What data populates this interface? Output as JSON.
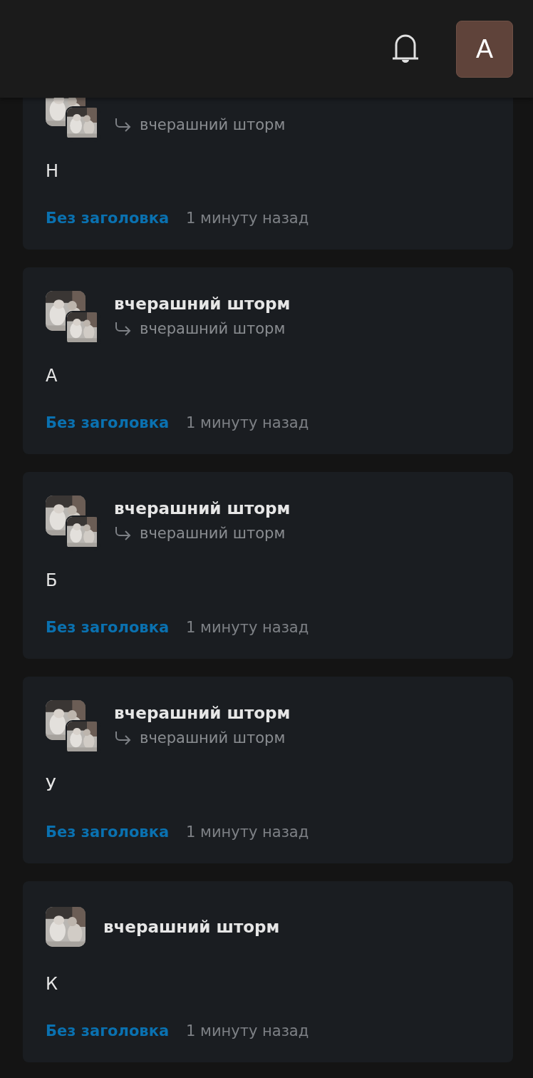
{
  "header": {
    "avatar_letter": "A"
  },
  "posts": [
    {
      "reply_to": "вчерашний шторм",
      "text": "Н",
      "title": "Без заголовка",
      "time": "1 минуту назад"
    },
    {
      "author": "вчерашний шторм",
      "reply_to": "вчерашний шторм",
      "text": "А",
      "title": "Без заголовка",
      "time": "1 минуту назад"
    },
    {
      "author": "вчерашний шторм",
      "reply_to": "вчерашний шторм",
      "text": "Б",
      "title": "Без заголовка",
      "time": "1 минуту назад"
    },
    {
      "author": "вчерашний шторм",
      "reply_to": "вчерашний шторм",
      "text": "У",
      "title": "Без заголовка",
      "time": "1 минуту назад"
    },
    {
      "author": "вчерашний шторм",
      "text": "К",
      "title": "Без заголовка",
      "time": "1 минуту назад"
    }
  ]
}
